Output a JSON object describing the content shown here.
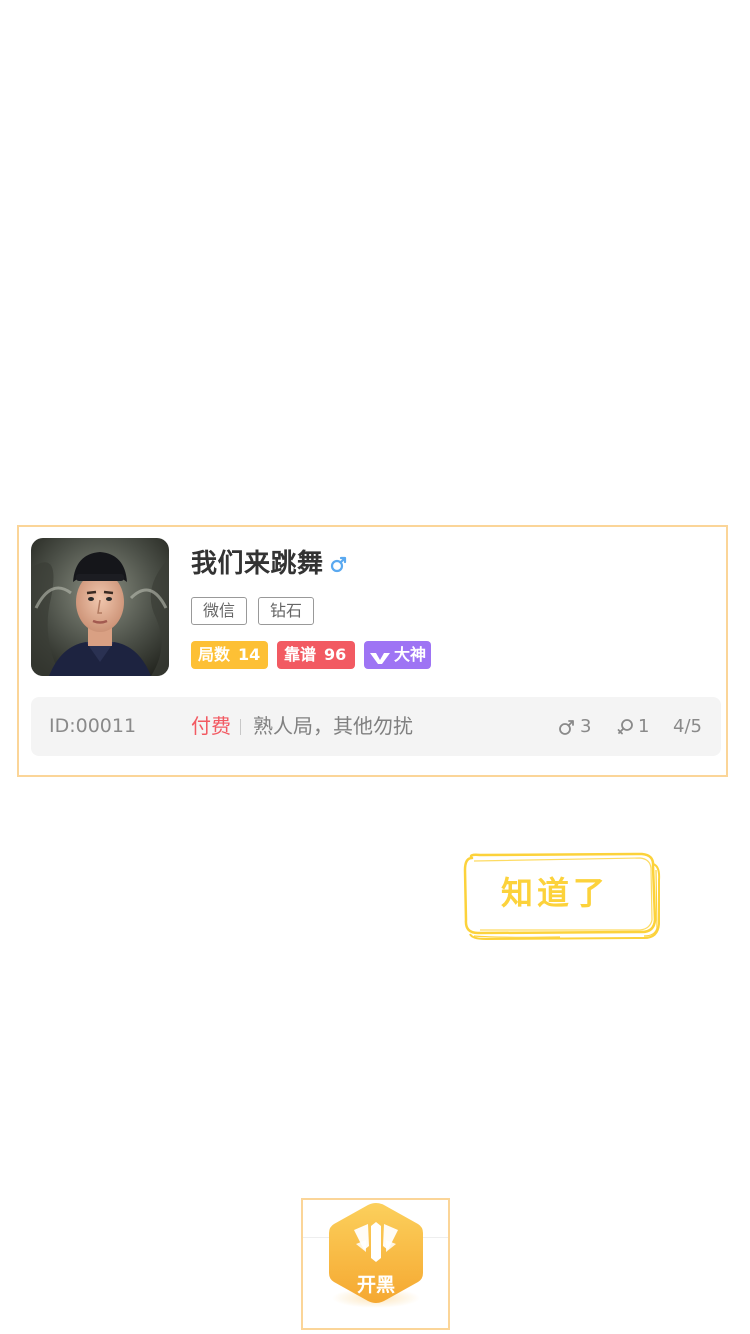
{
  "room_card": {
    "name": "我们来跳舞",
    "gender": "male",
    "tags": [
      "微信",
      "钻石"
    ],
    "badges": {
      "games_label": "局数",
      "games_value": "14",
      "reputation_label": "靠谱",
      "reputation_value": "96",
      "god_label": "大神"
    },
    "info": {
      "room_id": "ID:00011",
      "pay_type": "付费",
      "description": "熟人局，其他勿扰",
      "male_count": "3",
      "female_count": "1",
      "member_count": "4/5"
    }
  },
  "got_it_button": {
    "label": "知道了"
  },
  "tab_bar": {
    "center_label": "开黑"
  },
  "colors": {
    "highlight_border": "#fbd598",
    "games_badge": "#fdc035",
    "reputation_badge": "#f25a62",
    "god_badge": "#9e74f4",
    "male_blue": "#5aa9f0",
    "pay_red": "#f25a62",
    "got_it_yellow": "#fcd23b",
    "tab_orange": "#f7b43b"
  }
}
